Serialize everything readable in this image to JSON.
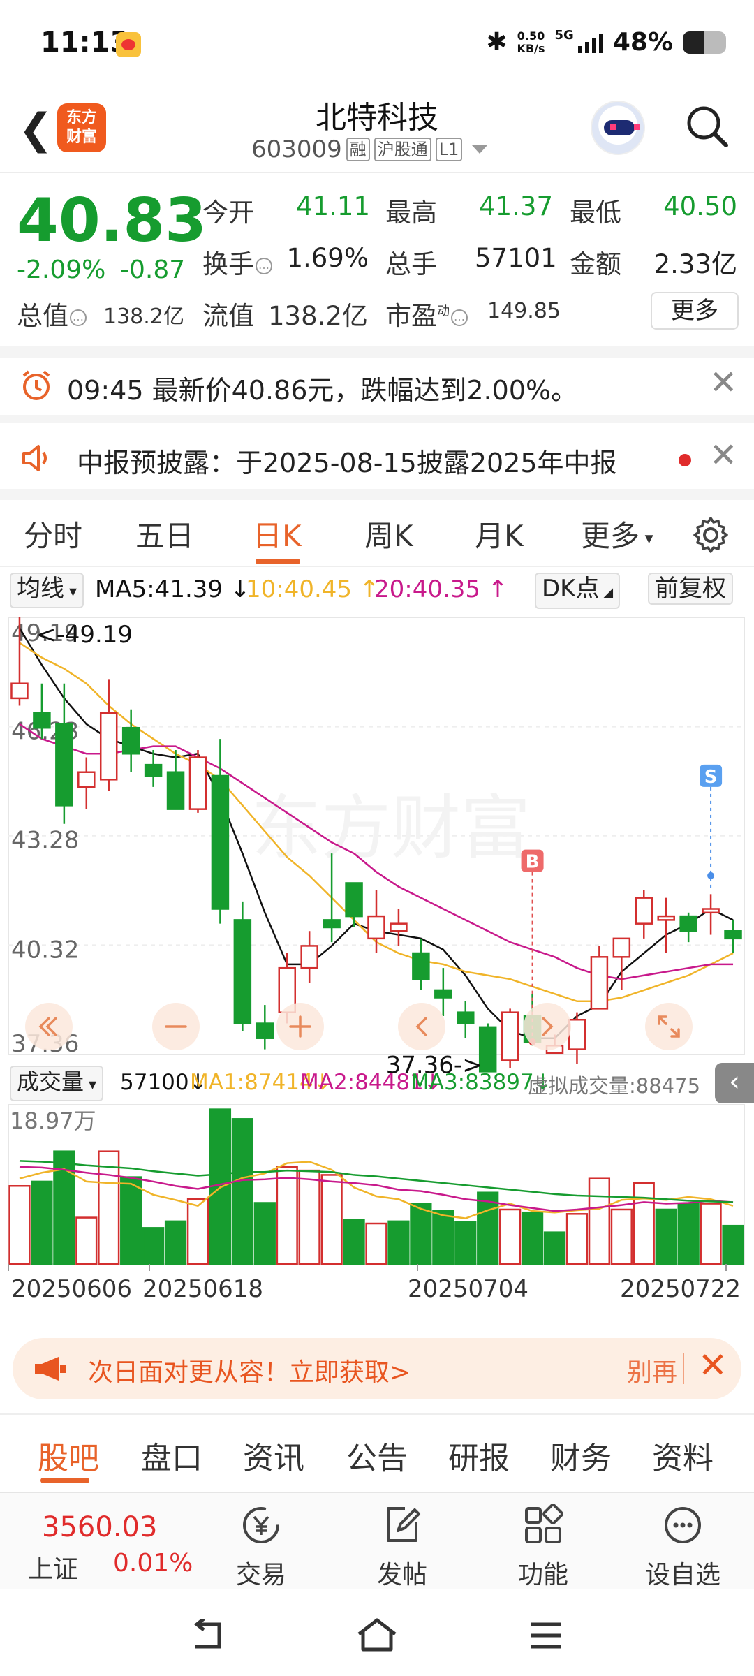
{
  "status_bar": {
    "time": "11:13",
    "net_speed_value": "0.50",
    "net_speed_unit": "KB/s",
    "network": "5G",
    "battery": "48%",
    "battery_level": 0.48
  },
  "header": {
    "back_icon": "back-arrow-icon",
    "logo_top": "东方",
    "logo_bottom": "财富",
    "stock_name": "北特科技",
    "stock_code": "603009",
    "tags": [
      "融",
      "沪股通",
      "L1"
    ]
  },
  "quote": {
    "price": "40.83",
    "change_pct": "-2.09%",
    "change_amt": "-0.87",
    "open_label": "今开",
    "open": "41.11",
    "high_label": "最高",
    "high": "41.37",
    "low_label": "最低",
    "low": "40.50",
    "turnover_label": "换手",
    "turnover": "1.69%",
    "volume_label": "总手",
    "volume": "57101",
    "amount_label": "金额",
    "amount": "2.33亿",
    "mktcap_label": "总值",
    "mktcap": "138.2亿",
    "float_label": "流值",
    "float_cap": "138.2亿",
    "pe_label": "市盈",
    "pe_sup": "动",
    "pe": "149.85",
    "more_label": "更多"
  },
  "alerts": [
    {
      "icon": "alarm-clock-icon",
      "text": "09:45 最新价40.86元，跌幅达到2.00%。"
    },
    {
      "icon": "speaker-icon",
      "text": "中报预披露：于2025-08-15披露2025年中报"
    }
  ],
  "period_tabs": [
    "分时",
    "五日",
    "日K",
    "周K",
    "月K",
    "更多"
  ],
  "active_period": "日K",
  "ma_bar": {
    "selector": "均线",
    "ma5": "MA5:41.39",
    "ma10": "10:40.45",
    "ma20": "20:40.35",
    "dk": "DK点",
    "adjust": "前复权"
  },
  "chart_data": [
    {
      "type": "candlestick",
      "y_ticks": [
        "49.19",
        "46.23",
        "43.28",
        "40.32",
        "37.36"
      ],
      "ylim": [
        37.36,
        49.19
      ],
      "annotations": [
        "<-49.19",
        "37.36->",
        "B",
        "S"
      ],
      "watermark": "东方财富",
      "candles": [
        {
          "o": 47.0,
          "h": 49.19,
          "l": 46.8,
          "c": 47.4
        },
        {
          "o": 46.6,
          "h": 47.4,
          "l": 45.9,
          "c": 46.2
        },
        {
          "o": 46.3,
          "h": 47.4,
          "l": 43.6,
          "c": 44.1
        },
        {
          "o": 44.6,
          "h": 45.4,
          "l": 44.0,
          "c": 45.0
        },
        {
          "o": 44.8,
          "h": 47.5,
          "l": 44.5,
          "c": 46.6
        },
        {
          "o": 46.2,
          "h": 46.7,
          "l": 45.0,
          "c": 45.5
        },
        {
          "o": 45.2,
          "h": 45.6,
          "l": 44.6,
          "c": 44.9
        },
        {
          "o": 45.0,
          "h": 45.6,
          "l": 44.3,
          "c": 44.0
        },
        {
          "o": 44.0,
          "h": 45.6,
          "l": 43.9,
          "c": 45.4
        },
        {
          "o": 44.9,
          "h": 45.9,
          "l": 40.9,
          "c": 41.3
        },
        {
          "o": 41.0,
          "h": 41.5,
          "l": 38.0,
          "c": 38.2
        },
        {
          "o": 38.2,
          "h": 38.7,
          "l": 37.5,
          "c": 37.8
        },
        {
          "o": 38.5,
          "h": 40.1,
          "l": 38.2,
          "c": 39.7
        },
        {
          "o": 39.7,
          "h": 40.7,
          "l": 39.3,
          "c": 40.3
        },
        {
          "o": 41.0,
          "h": 42.8,
          "l": 40.4,
          "c": 40.8
        },
        {
          "o": 42.0,
          "h": 42.0,
          "l": 40.8,
          "c": 41.1
        },
        {
          "o": 40.5,
          "h": 41.8,
          "l": 40.1,
          "c": 41.1
        },
        {
          "o": 40.7,
          "h": 41.3,
          "l": 40.3,
          "c": 40.9
        },
        {
          "o": 40.1,
          "h": 40.5,
          "l": 39.1,
          "c": 39.4
        },
        {
          "o": 39.1,
          "h": 39.7,
          "l": 38.4,
          "c": 38.9
        },
        {
          "o": 38.5,
          "h": 38.8,
          "l": 37.8,
          "c": 38.2
        },
        {
          "o": 38.1,
          "h": 38.2,
          "l": 36.9,
          "c": 36.9
        },
        {
          "o": 37.2,
          "h": 38.6,
          "l": 37.0,
          "c": 38.5
        },
        {
          "o": 38.4,
          "h": 39.0,
          "l": 37.6,
          "c": 37.7
        },
        {
          "o": 37.4,
          "h": 37.9,
          "l": 37.4,
          "c": 37.6
        },
        {
          "o": 37.5,
          "h": 38.5,
          "l": 37.1,
          "c": 38.3
        },
        {
          "o": 38.6,
          "h": 40.3,
          "l": 38.6,
          "c": 40.0
        },
        {
          "o": 40.0,
          "h": 40.5,
          "l": 39.1,
          "c": 40.5
        },
        {
          "o": 40.9,
          "h": 41.8,
          "l": 40.5,
          "c": 41.6
        },
        {
          "o": 41.0,
          "h": 41.6,
          "l": 40.1,
          "c": 41.1
        },
        {
          "o": 41.1,
          "h": 41.2,
          "l": 40.4,
          "c": 40.7
        },
        {
          "o": 41.2,
          "h": 41.7,
          "l": 40.6,
          "c": 41.3
        },
        {
          "o": 40.7,
          "h": 41.0,
          "l": 40.1,
          "c": 40.5
        }
      ],
      "ma_lines": [
        {
          "name": "MA5",
          "color": "#111111",
          "values": [
            48.9,
            47.9,
            47.0,
            46.3,
            45.9,
            45.7,
            45.5,
            45.4,
            45.5,
            44.3,
            42.8,
            41.2,
            39.8,
            39.8,
            40.3,
            40.9,
            40.7,
            40.6,
            40.5,
            40.2,
            39.5,
            38.6,
            38.0,
            37.8,
            37.8,
            38.4,
            38.7,
            39.6,
            40.1,
            40.6,
            40.9,
            41.3,
            41.0
          ]
        },
        {
          "name": "MA10",
          "color": "#f0b429",
          "values": [
            48.5,
            48.1,
            47.8,
            47.4,
            46.8,
            46.3,
            45.9,
            45.5,
            45.2,
            44.8,
            44.1,
            43.4,
            42.7,
            42.2,
            41.6,
            41.0,
            40.4,
            40.1,
            39.9,
            39.8,
            39.6,
            39.5,
            39.4,
            39.2,
            39.0,
            38.8,
            38.8,
            38.9,
            39.1,
            39.3,
            39.5,
            39.8,
            40.1
          ]
        },
        {
          "name": "MA20",
          "color": "#c8198b",
          "values": [
            46.3,
            45.9,
            45.7,
            45.5,
            45.5,
            45.6,
            45.7,
            45.7,
            45.4,
            45.1,
            44.7,
            44.3,
            43.9,
            43.5,
            43.1,
            42.8,
            42.3,
            41.9,
            41.6,
            41.3,
            41.0,
            40.7,
            40.4,
            40.2,
            40.0,
            39.7,
            39.5,
            39.4,
            39.5,
            39.6,
            39.7,
            39.8,
            39.8
          ]
        }
      ],
      "buy_signal_index": 23,
      "sell_signal_index": 31
    },
    {
      "type": "bar",
      "title": "成交量",
      "y_tick": "18.97万",
      "ylim": [
        0,
        18.97
      ],
      "unit": "万",
      "values": [
        10.6,
        11.2,
        15.3,
        6.3,
        15.3,
        11.8,
        4.9,
        5.8,
        8.8,
        21.0,
        19.7,
        8.3,
        13.2,
        12.7,
        12.1,
        6.0,
        5.5,
        5.8,
        8.2,
        7.2,
        5.7,
        9.7,
        7.4,
        7.0,
        4.3,
        6.8,
        11.6,
        7.4,
        11.0,
        7.4,
        8.2,
        8.2,
        5.2
      ],
      "up": [
        true,
        false,
        false,
        true,
        true,
        false,
        false,
        false,
        true,
        false,
        false,
        false,
        true,
        true,
        true,
        false,
        true,
        false,
        false,
        false,
        false,
        false,
        true,
        false,
        false,
        true,
        true,
        true,
        true,
        false,
        false,
        true,
        false
      ],
      "ma_lines": [
        {
          "name": "MA1",
          "color": "#f0b429",
          "values": [
            11.6,
            12.4,
            12.9,
            11.2,
            11.0,
            10.9,
            9.4,
            8.7,
            7.9,
            10.4,
            11.7,
            12.3,
            13.7,
            13.9,
            12.8,
            10.4,
            9.2,
            8.8,
            7.5,
            6.6,
            6.2,
            7.3,
            8.2,
            7.2,
            7.0,
            7.3,
            7.5,
            8.7,
            8.9,
            8.7,
            9.1,
            8.8,
            7.9
          ]
        },
        {
          "name": "MA2",
          "color": "#c8198b",
          "values": [
            13.2,
            13.1,
            12.8,
            12.4,
            12.1,
            11.7,
            11.2,
            10.6,
            10.2,
            10.8,
            11.4,
            11.5,
            11.7,
            11.5,
            11.2,
            11.0,
            10.7,
            10.1,
            9.9,
            9.4,
            8.8,
            8.5,
            8.0,
            7.6,
            7.2,
            7.4,
            7.7,
            8.0,
            8.4,
            8.2,
            8.3,
            8.6,
            8.4
          ]
        },
        {
          "name": "MA3",
          "color": "#169c2f",
          "values": [
            14.0,
            13.9,
            13.7,
            13.4,
            13.2,
            13.0,
            12.6,
            12.3,
            12.0,
            12.2,
            12.5,
            12.5,
            12.7,
            12.6,
            12.5,
            12.1,
            11.9,
            11.6,
            11.3,
            11.0,
            10.7,
            10.4,
            10.1,
            9.8,
            9.5,
            9.3,
            9.2,
            9.1,
            9.0,
            8.8,
            8.6,
            8.5,
            8.4
          ]
        }
      ]
    }
  ],
  "volume_bar": {
    "selector": "成交量",
    "vol": "57100↓",
    "ma1": "MA1:87414↓",
    "ma2": "MA2:84481↓",
    "ma3": "MA3:83897↓",
    "virtual": "虚拟成交量:88475"
  },
  "dates": [
    "20250606",
    "20250618",
    "20250704",
    "20250722"
  ],
  "banner": {
    "text": "次日面对更从容！立即获取>",
    "right": "别再"
  },
  "bottom_tabs": [
    "股吧",
    "盘口",
    "资讯",
    "公告",
    "研报",
    "财务",
    "资料"
  ],
  "active_bottom_tab": "股吧",
  "footer": {
    "index_value": "3560.03",
    "index_name": "上证",
    "index_change": "0.01%",
    "buttons": [
      {
        "icon": "trade-yen-icon",
        "label": "交易"
      },
      {
        "icon": "edit-post-icon",
        "label": "发帖"
      },
      {
        "icon": "function-grid-icon",
        "label": "功能"
      },
      {
        "icon": "more-circle-icon",
        "label": "设自选"
      }
    ]
  },
  "colors": {
    "up": "#d32f2f",
    "down": "#169c2f",
    "accent": "#e8632a",
    "ma5": "#111111",
    "ma10": "#f0b429",
    "ma20": "#c8198b"
  }
}
